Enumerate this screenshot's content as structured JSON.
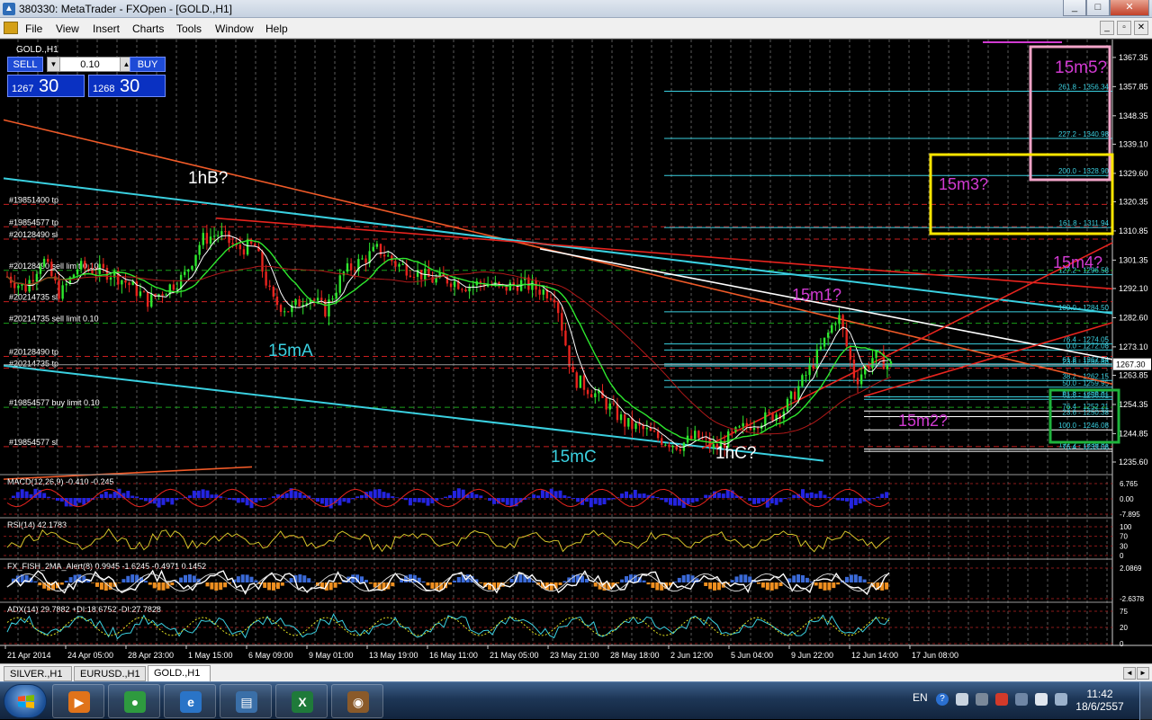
{
  "window": {
    "title": "380330: MetaTrader - FXOpen - [GOLD.,H1]",
    "controls": [
      "_",
      "□",
      "✕"
    ]
  },
  "menu": [
    "File",
    "View",
    "Insert",
    "Charts",
    "Tools",
    "Window",
    "Help"
  ],
  "mdi_controls": [
    "_",
    "▫",
    "✕"
  ],
  "chart": {
    "symbol_label": "GOLD.,H1",
    "one_click": {
      "sell_label": "SELL",
      "buy_label": "BUY",
      "lot": "0.10",
      "lot_down": "▼",
      "lot_up": "▲",
      "bid_small": "1267",
      "bid_big": "30",
      "ask_small": "1268",
      "ask_big": "30"
    },
    "current_price": "1267.30",
    "price_scale": [
      {
        "label": "1367.35",
        "price": 1367.35
      },
      {
        "label": "1357.85",
        "price": 1357.85
      },
      {
        "label": "1348.35",
        "price": 1348.35
      },
      {
        "label": "1339.10",
        "price": 1339.1
      },
      {
        "label": "1329.60",
        "price": 1329.6
      },
      {
        "label": "1320.35",
        "price": 1320.35
      },
      {
        "label": "1310.85",
        "price": 1310.85
      },
      {
        "label": "1301.35",
        "price": 1301.35
      },
      {
        "label": "1292.10",
        "price": 1292.1
      },
      {
        "label": "1282.60",
        "price": 1282.6
      },
      {
        "label": "1273.10",
        "price": 1273.1
      },
      {
        "label": "1263.85",
        "price": 1263.85
      },
      {
        "label": "1254.35",
        "price": 1254.35
      },
      {
        "label": "1244.85",
        "price": 1244.85
      },
      {
        "label": "1235.60",
        "price": 1235.6
      }
    ],
    "order_lines": [
      {
        "label": "#19851400 tp",
        "price": 1319.5,
        "color": "#c81e1e"
      },
      {
        "label": "#19854577 tp",
        "price": 1312.2,
        "color": "#c81e1e"
      },
      {
        "label": "#20128490 sl",
        "price": 1308.2,
        "color": "#c81e1e"
      },
      {
        "label": "#20128490 sell limit 0.10",
        "price": 1298.0,
        "color": "#1aa01a"
      },
      {
        "label": "#20214735 sl",
        "price": 1287.8,
        "color": "#c81e1e"
      },
      {
        "label": "#20214735 sell limit 0.10",
        "price": 1280.8,
        "color": "#1aa01a"
      },
      {
        "label": "#20128490 tp",
        "price": 1270.0,
        "color": "#c81e1e"
      },
      {
        "label": "#20214735 tp",
        "price": 1266.2,
        "color": "#c81e1e"
      },
      {
        "label": "#19854577 buy limit 0.10",
        "price": 1253.4,
        "color": "#1aa01a"
      },
      {
        "label": "#19854577 sl",
        "price": 1240.6,
        "color": "#c81e1e"
      }
    ],
    "fib_levels": [
      {
        "label": "261.8 - 1356.34",
        "price": 1356.34
      },
      {
        "label": "227.2 - 1340.98",
        "price": 1340.98
      },
      {
        "label": "200.0 - 1328.90",
        "price": 1328.9
      },
      {
        "label": "161.8 - 1311.94",
        "price": 1311.94
      },
      {
        "label": "127.2 - 1296.58",
        "price": 1296.58
      },
      {
        "label": "100.0 - 1284.50",
        "price": 1284.5
      },
      {
        "label": "76.4 - 1274.05",
        "price": 1274.05
      },
      {
        "label": "0.0 - 1272.08",
        "price": 1272.08
      },
      {
        "label": "61.8 - 1267.54",
        "price": 1267.54
      },
      {
        "label": "23.6 - 1266.88",
        "price": 1266.88
      },
      {
        "label": "38.2 - 1262.15",
        "price": 1262.15
      },
      {
        "label": "50.0 - 1259.95",
        "price": 1259.95
      },
      {
        "label": "61.8 - 1256.81",
        "price": 1256.81
      },
      {
        "label": "61.8 - 1256.01",
        "price": 1256.01
      },
      {
        "label": "76.4 - 1252.21",
        "price": 1252.21
      },
      {
        "label": "23.6 - 1250.38",
        "price": 1250.38
      },
      {
        "label": "100.0 - 1246.08",
        "price": 1246.08
      },
      {
        "label": "127.2 - 1239.81",
        "price": 1239.81
      },
      {
        "label": "76.4 - 1239.08",
        "price": 1239.08
      }
    ],
    "annotations": [
      {
        "text": "1hB?",
        "color": "#ffffff"
      },
      {
        "text": "15mA",
        "color": "#3ad0e0"
      },
      {
        "text": "15mC",
        "color": "#3ad0e0"
      },
      {
        "text": "1hC?",
        "color": "#ffffff"
      },
      {
        "text": "15m1?",
        "color": "#d23ad2"
      },
      {
        "text": "15m2?",
        "color": "#d23ad2"
      },
      {
        "text": "15m3?",
        "color": "#d23ad2"
      },
      {
        "text": "15m4?",
        "color": "#d23ad2"
      },
      {
        "text": "15m5?",
        "color": "#d23ad2"
      }
    ],
    "time_labels": [
      "21 Apr 2014",
      "24 Apr 05:00",
      "28 Apr 23:00",
      "1 May 15:00",
      "6 May 09:00",
      "9 May 01:00",
      "13 May 19:00",
      "16 May 11:00",
      "21 May 05:00",
      "23 May 21:00",
      "28 May 18:00",
      "2 Jun 12:00",
      "5 Jun 04:00",
      "9 Jun 22:00",
      "12 Jun 14:00",
      "17 Jun 08:00"
    ],
    "price_path": [
      {
        "t": 0.0,
        "p": 1296
      },
      {
        "t": 0.02,
        "p": 1292
      },
      {
        "t": 0.04,
        "p": 1302
      },
      {
        "t": 0.06,
        "p": 1290
      },
      {
        "t": 0.08,
        "p": 1299
      },
      {
        "t": 0.1,
        "p": 1298
      },
      {
        "t": 0.12,
        "p": 1297
      },
      {
        "t": 0.14,
        "p": 1293
      },
      {
        "t": 0.16,
        "p": 1288
      },
      {
        "t": 0.18,
        "p": 1292
      },
      {
        "t": 0.2,
        "p": 1296
      },
      {
        "t": 0.22,
        "p": 1308
      },
      {
        "t": 0.24,
        "p": 1310
      },
      {
        "t": 0.26,
        "p": 1305
      },
      {
        "t": 0.28,
        "p": 1306
      },
      {
        "t": 0.3,
        "p": 1288
      },
      {
        "t": 0.32,
        "p": 1285
      },
      {
        "t": 0.34,
        "p": 1290
      },
      {
        "t": 0.36,
        "p": 1285
      },
      {
        "t": 0.38,
        "p": 1297
      },
      {
        "t": 0.4,
        "p": 1301
      },
      {
        "t": 0.42,
        "p": 1305
      },
      {
        "t": 0.44,
        "p": 1300
      },
      {
        "t": 0.46,
        "p": 1298
      },
      {
        "t": 0.48,
        "p": 1295
      },
      {
        "t": 0.5,
        "p": 1295
      },
      {
        "t": 0.52,
        "p": 1293
      },
      {
        "t": 0.54,
        "p": 1294
      },
      {
        "t": 0.56,
        "p": 1292
      },
      {
        "t": 0.58,
        "p": 1294
      },
      {
        "t": 0.6,
        "p": 1292
      },
      {
        "t": 0.62,
        "p": 1290
      },
      {
        "t": 0.64,
        "p": 1263
      },
      {
        "t": 0.66,
        "p": 1259
      },
      {
        "t": 0.68,
        "p": 1254
      },
      {
        "t": 0.7,
        "p": 1248
      },
      {
        "t": 0.72,
        "p": 1246
      },
      {
        "t": 0.74,
        "p": 1243
      },
      {
        "t": 0.76,
        "p": 1241
      },
      {
        "t": 0.78,
        "p": 1244
      },
      {
        "t": 0.8,
        "p": 1240
      },
      {
        "t": 0.82,
        "p": 1244
      },
      {
        "t": 0.84,
        "p": 1248
      },
      {
        "t": 0.86,
        "p": 1250
      },
      {
        "t": 0.88,
        "p": 1253
      },
      {
        "t": 0.9,
        "p": 1262
      },
      {
        "t": 0.92,
        "p": 1272
      },
      {
        "t": 0.94,
        "p": 1284
      },
      {
        "t": 0.96,
        "p": 1262
      },
      {
        "t": 0.98,
        "p": 1270
      },
      {
        "t": 1.0,
        "p": 1267
      }
    ]
  },
  "indicators": {
    "macd": {
      "label": "MACD(12,26,9) -0.410 -0.245",
      "levels": [
        "6.765",
        "0.00",
        "-7.895"
      ]
    },
    "rsi": {
      "label": "RSI(14) 42.1783",
      "levels": [
        "100",
        "70",
        "30",
        "0"
      ]
    },
    "fish": {
      "label": "FX_FISH_2MA_Alert(8) 0.9945 -1.6245 -0.4971 0.1452",
      "levels": [
        "2.0869",
        "-2.6378"
      ]
    },
    "adx": {
      "label": "ADX(14) 29.7882 +DI:18.6752 -DI:27.7828",
      "levels": [
        "75",
        "20",
        "0"
      ]
    }
  },
  "tabs": [
    "SILVER.,H1",
    "EURUSD.,H1",
    "GOLD.,H1"
  ],
  "active_tab": 2,
  "tab_nav": [
    "◄",
    "►"
  ],
  "taskbar": {
    "apps": [
      {
        "name": "media-player",
        "glyph": "▶",
        "color": "#e0731a"
      },
      {
        "name": "chrome",
        "glyph": "●",
        "color": "#2e9a3f"
      },
      {
        "name": "internet-explorer",
        "glyph": "e",
        "color": "#2a74c7"
      },
      {
        "name": "metatrader",
        "glyph": "▤",
        "color": "#3a6fa8"
      },
      {
        "name": "excel",
        "glyph": "X",
        "color": "#1f7a3a"
      },
      {
        "name": "app-eagle",
        "glyph": "◉",
        "color": "#8a5a2a"
      }
    ],
    "language": "EN",
    "time": "11:42",
    "date": "18/6/2557"
  },
  "colors": {
    "bull": "#2ee82e",
    "bear": "#e8241e",
    "fib": "#3ad0e0",
    "grid": "#5a5a5a",
    "label_magenta": "#d23ad2",
    "box_yellow": "#ffe600",
    "box_pink": "#f2a4c8",
    "box_green": "#1eb43c"
  }
}
